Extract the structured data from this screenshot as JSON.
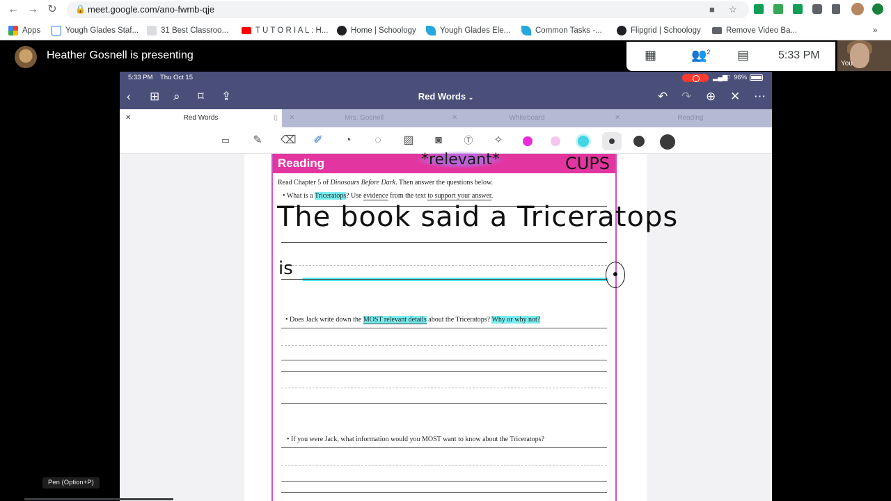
{
  "browser": {
    "url": "meet.google.com/ano-fwmb-qje",
    "bookmarks": [
      {
        "label": "Apps",
        "icon": "apps-grid-icon",
        "color": "#4285f4"
      },
      {
        "label": "Yough Glades Staf...",
        "icon": "page-icon",
        "color": "#5f6368"
      },
      {
        "label": "31 Best Classroo...",
        "icon": "site-icon",
        "color": "#9aa0a6"
      },
      {
        "label": "T U T O R I A L : H...",
        "icon": "youtube-icon",
        "color": "#ff0000"
      },
      {
        "label": "Home | Schoology",
        "icon": "schoology-icon",
        "color": "#1e1e1e"
      },
      {
        "label": "Yough Glades Ele...",
        "icon": "feather-icon",
        "color": "#26a7de"
      },
      {
        "label": "Common Tasks -...",
        "icon": "feather-icon",
        "color": "#26a7de"
      },
      {
        "label": "Flipgrid | Schoology",
        "icon": "schoology-icon",
        "color": "#1e1e1e"
      },
      {
        "label": "Remove Video Ba...",
        "icon": "video-icon",
        "color": "#5f6368"
      }
    ],
    "more_bookmarks": "»"
  },
  "meet": {
    "presenting_text": "Heather Gosnell is presenting",
    "participants_count": "2",
    "time": "5:33 PM",
    "self_label": "You",
    "tooltip": "Pen (Option+P)"
  },
  "ipad": {
    "status_time": "5:33 PM",
    "status_date": "Thu Oct 15",
    "battery": "96%",
    "doc_title": "Red Words",
    "tabs": [
      {
        "label": "Red Words",
        "active": true
      },
      {
        "label": "Mrs. Gosnell",
        "active": false
      },
      {
        "label": "Whiteboard",
        "active": false
      },
      {
        "label": "Reading",
        "active": false
      }
    ],
    "colors": {
      "magenta": "#ec2bd8",
      "pink": "#f4c6ef",
      "cyan": "#3fd6e6",
      "dark": "#3a3a3a"
    }
  },
  "worksheet": {
    "header": "Reading",
    "intro_1": "Read Chapter 5 of ",
    "intro_book": "Dinosaurs Before Dark",
    "intro_2": ". Then answer the questions below.",
    "q1_a": "What is a ",
    "q1_hl": "Triceratops",
    "q1_b": "? Use ",
    "q1_c": "evidence",
    "q1_d": " from the text ",
    "q1_e": "to support your answer",
    "q1_f": ".",
    "q2_a": "Does Jack write down the ",
    "q2_hl": "MOST relevant details",
    "q2_b": " about the Triceratops? ",
    "q2_hl2": "Why or why not?",
    "q3": "If you were Jack, what information would you MOST want to know about the Triceratops?",
    "handwriting_relevant": "*relevant*",
    "handwriting_answer": "The book said a Triceratops",
    "handwriting_is": "is",
    "handwriting_cup": "CUPS"
  }
}
